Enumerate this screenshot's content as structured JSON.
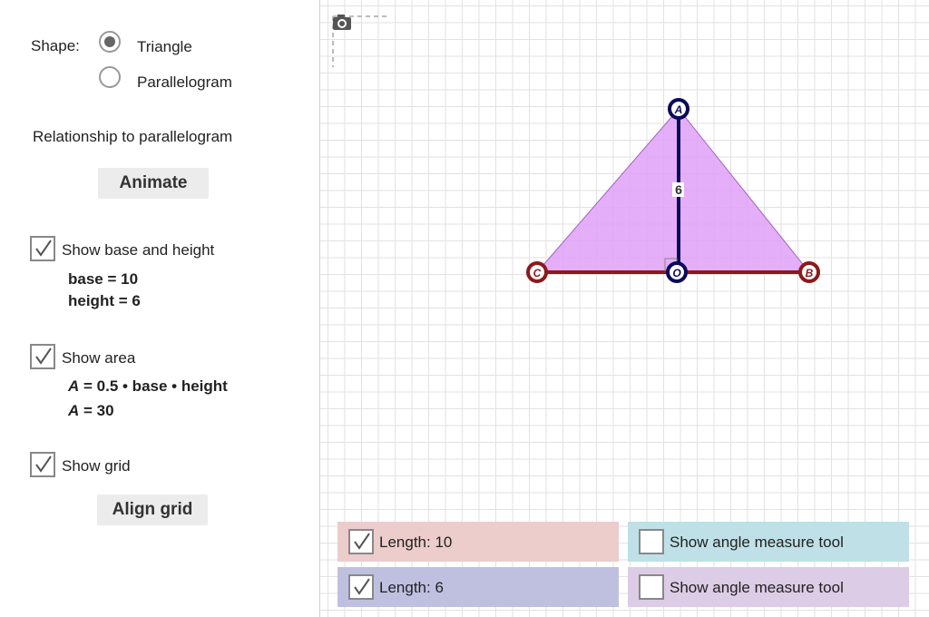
{
  "left": {
    "shape_label": "Shape:",
    "shape_options": [
      {
        "label": "Triangle",
        "selected": true
      },
      {
        "label": "Parallelogram",
        "selected": false
      }
    ],
    "relationship_label": "Relationship to parallelogram",
    "animate_button": "Animate",
    "base_height": {
      "label": "Show base and height",
      "checked": true,
      "base_text": "base = 10",
      "height_text": "height = 6"
    },
    "area": {
      "label": "Show area",
      "checked": true,
      "formula_var": "A",
      "formula_rest": " = 0.5 • base • height",
      "result_var": "A",
      "result_rest": " = 30"
    },
    "grid": {
      "label": "Show grid",
      "checked": true
    },
    "align_button": "Align grid"
  },
  "canvas": {
    "points": {
      "A": "A",
      "B": "B",
      "C": "C",
      "O": "O",
      "height_label": "6"
    },
    "colors": {
      "fill": "#e0a0f8",
      "base": "#8b1a1a",
      "height": "#0a0a5a"
    },
    "panels": [
      {
        "label": "Length: 10",
        "checked": true,
        "color": "#edcccc"
      },
      {
        "label": "Show angle measure tool",
        "checked": false,
        "color": "#bfe0e6"
      },
      {
        "label": "Length: 6",
        "checked": true,
        "color": "#bfc0e0"
      },
      {
        "label": "Show angle measure tool",
        "checked": false,
        "color": "#dccce6"
      }
    ]
  }
}
